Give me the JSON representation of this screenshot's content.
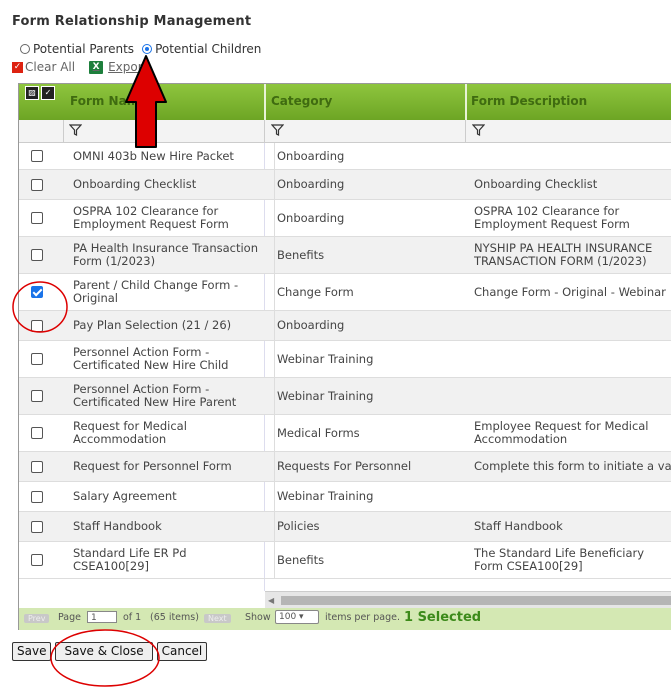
{
  "page": {
    "title": "Form Relationship Management",
    "radios": [
      {
        "label": "Potential Parents",
        "selected": false
      },
      {
        "label": "Potential Children",
        "selected": true
      }
    ],
    "clear_all": "Clear All",
    "export": "Export"
  },
  "grid": {
    "columns": [
      "Form Name",
      "Category",
      "Form Description"
    ],
    "rows": [
      {
        "name": "OMNI 403b New Hire Packet",
        "category": "Onboarding",
        "description": "",
        "checked": false
      },
      {
        "name": "Onboarding Checklist",
        "category": "Onboarding",
        "description": "Onboarding Checklist",
        "checked": false
      },
      {
        "name": "OSPRA 102 Clearance for Employment Request Form",
        "category": "Onboarding",
        "description": "OSPRA 102 Clearance for Employment Request Form",
        "checked": false
      },
      {
        "name": "PA Health Insurance Transaction Form (1/2023)",
        "category": "Benefits",
        "description": "NYSHIP PA HEALTH INSURANCE TRANSACTION FORM (1/2023)",
        "checked": false
      },
      {
        "name": "Parent / Child Change Form - Original",
        "category": "Change Form",
        "description": "Change Form - Original - Webinar",
        "checked": true
      },
      {
        "name": "Pay Plan Selection (21 / 26)",
        "category": "Onboarding",
        "description": "",
        "checked": false
      },
      {
        "name": "Personnel Action Form - Certificated New Hire Child",
        "category": "Webinar Training",
        "description": "",
        "checked": false
      },
      {
        "name": "Personnel Action Form - Certificated New Hire Parent",
        "category": "Webinar Training",
        "description": "",
        "checked": false
      },
      {
        "name": "Request for Medical Accommodation",
        "category": "Medical Forms",
        "description": "Employee Request for Medical Accommodation",
        "checked": false
      },
      {
        "name": "Request for Personnel Form",
        "category": "Requests For Personnel",
        "description": "Complete this form to initiate a vacancy",
        "checked": false
      },
      {
        "name": "Salary Agreement",
        "category": "Webinar Training",
        "description": "",
        "checked": false
      },
      {
        "name": "Staff Handbook",
        "category": "Policies",
        "description": "Staff Handbook",
        "checked": false
      },
      {
        "name": "Standard Life ER Pd CSEA100[29]",
        "category": "Benefits",
        "description": "The Standard Life Beneficiary Form CSEA100[29]",
        "checked": false
      }
    ]
  },
  "pager": {
    "prev": "Prev",
    "page_label": "Page",
    "page_value": "1",
    "of_label": "of 1",
    "items": "(65 items)",
    "next": "Next",
    "show_label": "Show",
    "per_page_value": "100",
    "per_page_label": "items per page.",
    "selected": "1 Selected"
  },
  "buttons": {
    "save": "Save",
    "save_close": "Save & Close",
    "cancel": "Cancel"
  },
  "colors": {
    "header_green": "#7db733",
    "annotation_red": "#dd0000",
    "selected_green": "#3c8a1a"
  }
}
